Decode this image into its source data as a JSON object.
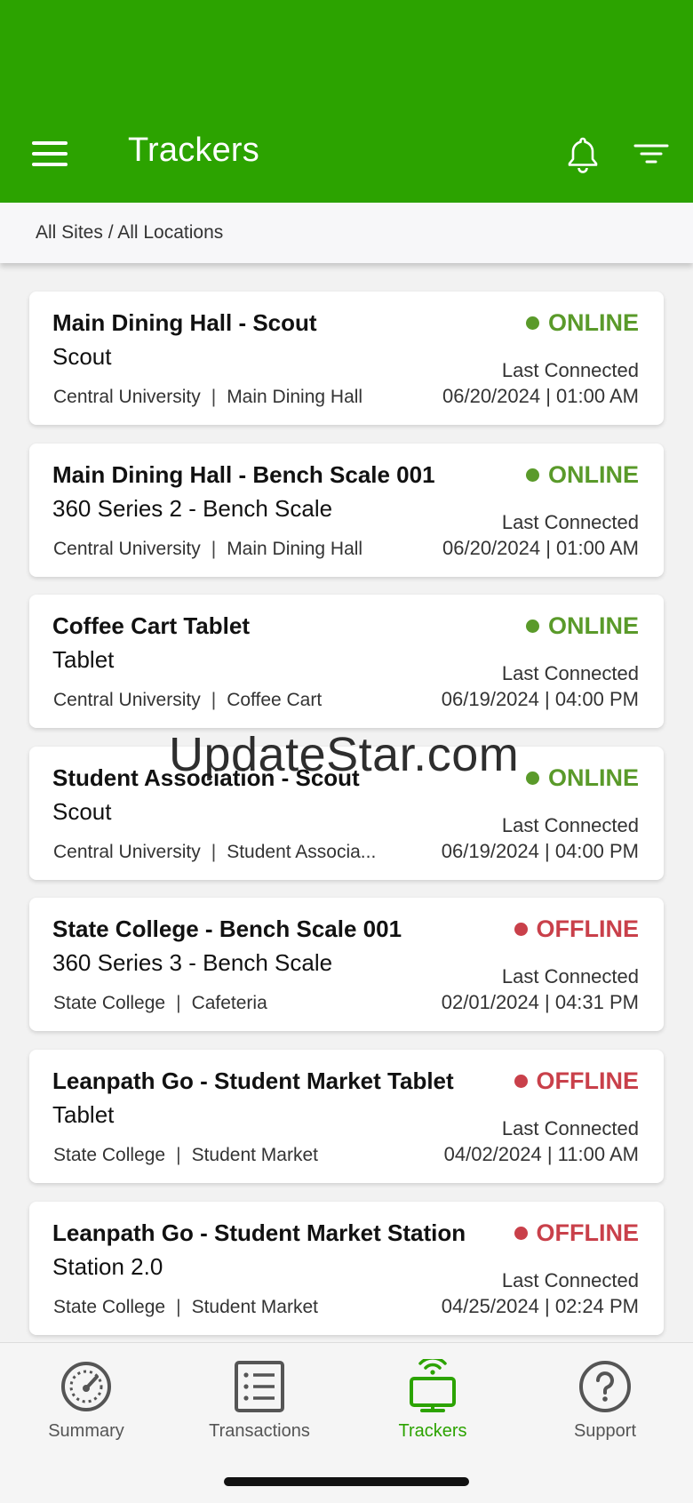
{
  "header": {
    "title": "Trackers",
    "menu_icon": "hamburger-menu-icon",
    "bell_icon": "bell-icon",
    "filter_icon": "filter-icon",
    "bg_color": "#2ca300"
  },
  "breadcrumb": "All Sites / All Locations",
  "status_colors": {
    "online": "#5a9a2a",
    "offline": "#c9404a"
  },
  "trackers": [
    {
      "name": "Main Dining Hall - Scout",
      "type": "Scout",
      "site": "Central University",
      "location": "Main Dining Hall",
      "status": "ONLINE",
      "last_label": "Last Connected",
      "last_time": "06/20/2024 | 01:00 AM"
    },
    {
      "name": "Main Dining Hall - Bench Scale 001",
      "type": "360 Series 2 - Bench Scale",
      "site": "Central University",
      "location": "Main Dining Hall",
      "status": "ONLINE",
      "last_label": "Last Connected",
      "last_time": "06/20/2024 | 01:00 AM"
    },
    {
      "name": "Coffee Cart Tablet",
      "type": "Tablet",
      "site": "Central University",
      "location": "Coffee Cart",
      "status": "ONLINE",
      "last_label": "Last Connected",
      "last_time": "06/19/2024 | 04:00 PM"
    },
    {
      "name": "Student Association - Scout",
      "type": "Scout",
      "site": "Central University",
      "location": "Student Associa...",
      "status": "ONLINE",
      "last_label": "Last Connected",
      "last_time": "06/19/2024 | 04:00 PM"
    },
    {
      "name": "State College - Bench Scale 001",
      "type": "360 Series 3 - Bench Scale",
      "site": "State College",
      "location": "Cafeteria",
      "status": "OFFLINE",
      "last_label": "Last Connected",
      "last_time": "02/01/2024 | 04:31 PM"
    },
    {
      "name": "Leanpath Go - Student Market Tablet",
      "type": "Tablet",
      "site": "State College",
      "location": "Student Market",
      "status": "OFFLINE",
      "last_label": "Last Connected",
      "last_time": "04/02/2024 | 11:00 AM"
    },
    {
      "name": "Leanpath Go - Student Market Station",
      "type": "Station 2.0",
      "site": "State College",
      "location": "Student Market",
      "status": "OFFLINE",
      "last_label": "Last Connected",
      "last_time": "04/25/2024 | 02:24 PM"
    }
  ],
  "watermark": "UpdateStar.com",
  "bottom_nav": [
    {
      "label": "Summary",
      "icon": "speedometer-icon",
      "active": false
    },
    {
      "label": "Transactions",
      "icon": "list-icon",
      "active": false
    },
    {
      "label": "Trackers",
      "icon": "tracker-device-icon",
      "active": true
    },
    {
      "label": "Support",
      "icon": "help-icon",
      "active": false
    }
  ]
}
